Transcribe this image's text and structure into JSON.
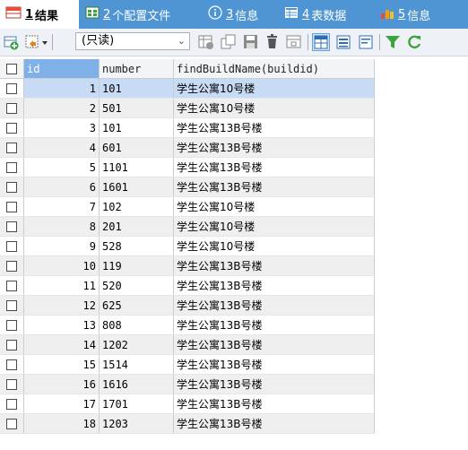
{
  "tabs": [
    {
      "num": "1",
      "label": "结果",
      "active": true
    },
    {
      "num": "2",
      "label": "个配置文件"
    },
    {
      "num": "3",
      "label": "信息"
    },
    {
      "num": "4",
      "label": "表数据"
    },
    {
      "num": "5",
      "label": "信息"
    }
  ],
  "toolbar": {
    "mode_value": "(只读)"
  },
  "columns": [
    "id",
    "number",
    "findBuildName(buildid)"
  ],
  "rows": [
    {
      "id": "1",
      "number": "101",
      "name": "学生公寓10号楼"
    },
    {
      "id": "2",
      "number": "501",
      "name": "学生公寓10号楼"
    },
    {
      "id": "3",
      "number": "101",
      "name": "学生公寓13B号楼"
    },
    {
      "id": "4",
      "number": "601",
      "name": "学生公寓13B号楼"
    },
    {
      "id": "5",
      "number": "1101",
      "name": "学生公寓13B号楼"
    },
    {
      "id": "6",
      "number": "1601",
      "name": "学生公寓13B号楼"
    },
    {
      "id": "7",
      "number": "102",
      "name": "学生公寓10号楼"
    },
    {
      "id": "8",
      "number": "201",
      "name": "学生公寓10号楼"
    },
    {
      "id": "9",
      "number": "528",
      "name": "学生公寓10号楼"
    },
    {
      "id": "10",
      "number": "119",
      "name": "学生公寓13B号楼"
    },
    {
      "id": "11",
      "number": "520",
      "name": "学生公寓13B号楼"
    },
    {
      "id": "12",
      "number": "625",
      "name": "学生公寓13B号楼"
    },
    {
      "id": "13",
      "number": "808",
      "name": "学生公寓13B号楼"
    },
    {
      "id": "14",
      "number": "1202",
      "name": "学生公寓13B号楼"
    },
    {
      "id": "15",
      "number": "1514",
      "name": "学生公寓13B号楼"
    },
    {
      "id": "16",
      "number": "1616",
      "name": "学生公寓13B号楼"
    },
    {
      "id": "17",
      "number": "1701",
      "name": "学生公寓13B号楼"
    },
    {
      "id": "18",
      "number": "1203",
      "name": "学生公寓13B号楼"
    }
  ]
}
